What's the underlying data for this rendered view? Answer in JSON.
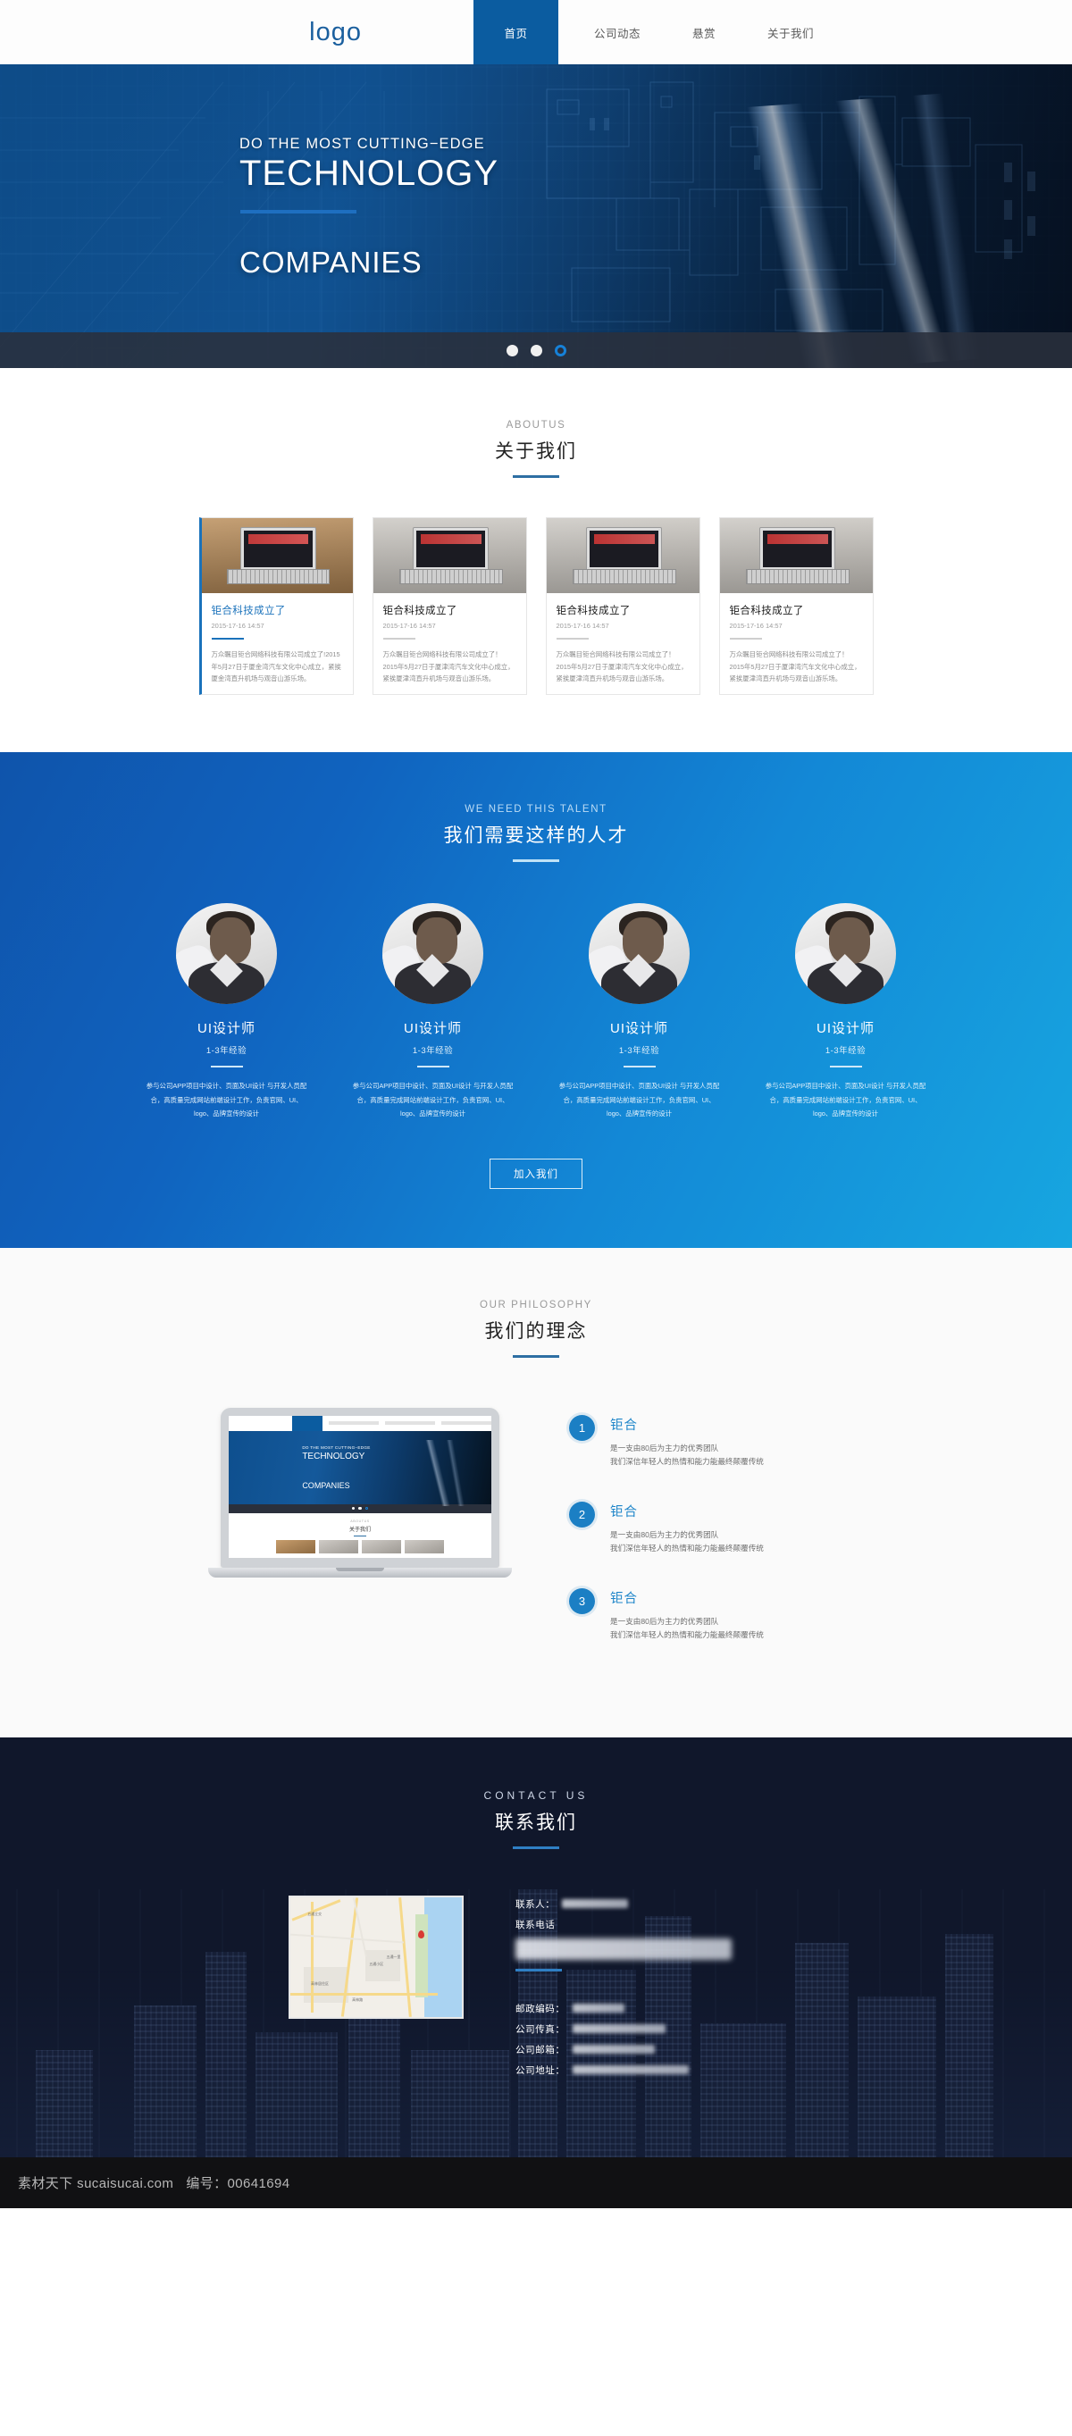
{
  "header": {
    "logo": "logo",
    "nav": [
      {
        "label": "首页",
        "active": true
      },
      {
        "label": "公司动态",
        "active": false
      },
      {
        "label": "悬赏",
        "active": false
      },
      {
        "label": "关于我们",
        "active": false
      }
    ]
  },
  "hero": {
    "kicker": "DO THE MOST CUTTING−EDGE",
    "title": "TECHNOLOGY",
    "subtitle": "COMPANIES",
    "dots": [
      "filled",
      "filled",
      "ring"
    ]
  },
  "about": {
    "en": "ABOUTUS",
    "cn": "关于我们",
    "cards": [
      {
        "title": "钜合科技成立了",
        "date": "2015-17-16 14:57",
        "desc": "万众瞩目钜合网络科技有限公司成立了!2015年5月27日于厦金湾汽车文化中心成立，紧挨厦金湾直升机场与观音山游乐场。",
        "active": true
      },
      {
        "title": "钜合科技成立了",
        "date": "2015-17-16 14:57",
        "desc": "万众瞩目钜合网络科技有限公司成立了！2015年5月27日于厦津湾汽车文化中心成立，紧挨厦津湾直升机场与观音山游乐场。",
        "active": false
      },
      {
        "title": "钜合科技成立了",
        "date": "2015-17-16 14:57",
        "desc": "万众瞩目钜合网络科技有限公司成立了！2015年5月27日于厦津湾汽车文化中心成立，紧挨厦津湾直升机场与观音山游乐场。",
        "active": false
      },
      {
        "title": "钜合科技成立了",
        "date": "2015-17-16 14:57",
        "desc": "万众瞩目钜合网络科技有限公司成立了！2015年5月27日于厦津湾汽车文化中心成立，紧挨厦津湾直升机场与观音山游乐场。",
        "active": false
      }
    ]
  },
  "talent": {
    "en": "WE NEED THIS TALENT",
    "cn": "我们需要这样的人才",
    "people": [
      {
        "role": "UI设计师",
        "experience": "1-3年经验",
        "desc": "参与公司APP项目中设计、页面及UI设计 与开发人员配合，高质量完成网站前端设计工作，负责官网、UI、logo、品牌宣传的设计"
      },
      {
        "role": "UI设计师",
        "experience": "1-3年经验",
        "desc": "参与公司APP项目中设计、页面及UI设计 与开发人员配合，高质量完成网站前端设计工作，负责官网、UI、logo、品牌宣传的设计"
      },
      {
        "role": "UI设计师",
        "experience": "1-3年经验",
        "desc": "参与公司APP项目中设计、页面及UI设计 与开发人员配合，高质量完成网站前端设计工作，负责官网、UI、logo、品牌宣传的设计"
      },
      {
        "role": "UI设计师",
        "experience": "1-3年经验",
        "desc": "参与公司APP项目中设计、页面及UI设计 与开发人员配合，高质量完成网站前端设计工作，负责官网、UI、logo、品牌宣传的设计"
      }
    ],
    "join_button": "加入我们"
  },
  "philosophy": {
    "en": "OUR PHILOSOPHY",
    "cn": "我们的理念",
    "laptop_screen": {
      "kicker": "DO THE MOST CUTTING−EDGE",
      "title": "TECHNOLOGY",
      "subtitle": "COMPANIES",
      "about_en": "ABOUTUS",
      "about_cn": "关于我们"
    },
    "items": [
      {
        "num": "1",
        "title": "钜合",
        "line1": "是一支由80后为主力的优秀团队",
        "line2": "我们深信年轻人的热情和能力能最终颠覆传统"
      },
      {
        "num": "2",
        "title": "钜合",
        "line1": "是一支由80后为主力的优秀团队",
        "line2": "我们深信年轻人的热情和能力能最终颠覆传统"
      },
      {
        "num": "3",
        "title": "钜合",
        "line1": "是一支由80后为主力的优秀团队",
        "line2": "我们深信年轻人的热情和能力能最终颠覆传统"
      }
    ]
  },
  "contact": {
    "en": "CONTACT US",
    "cn": "联系我们",
    "map_labels": [
      "五通立交",
      "五通小区",
      "高林居住区",
      "五通一里",
      "高林路"
    ],
    "fields": [
      {
        "label": "联系人：",
        "value": ""
      },
      {
        "label": "联系电话",
        "value": ""
      }
    ],
    "details": [
      {
        "label": "邮政编码：",
        "value": ""
      },
      {
        "label": "公司传真：",
        "value": ""
      },
      {
        "label": "公司邮箱：",
        "value": ""
      },
      {
        "label": "公司地址：",
        "value": ""
      }
    ]
  },
  "watermark": {
    "site": "素材天下 sucaisucai.com",
    "id": "编号：00641694"
  },
  "colors": {
    "brand_blue": "#0b5ca0",
    "accent_blue": "#1b7fc4",
    "hero_dark": "#04101f",
    "contact_dark": "#10172b"
  }
}
